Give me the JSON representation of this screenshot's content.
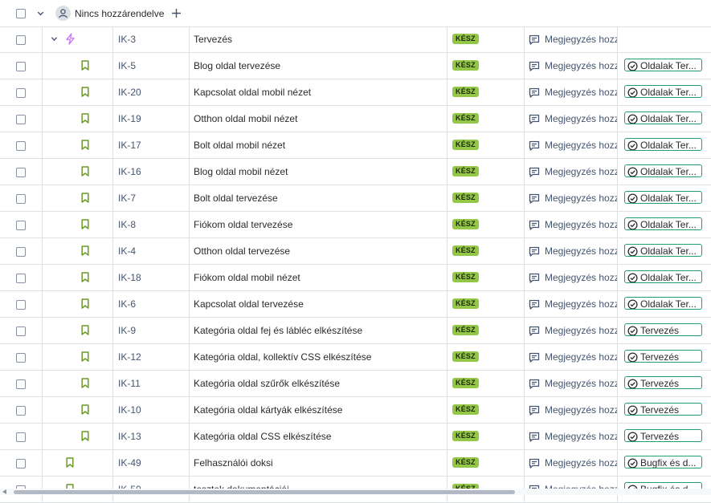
{
  "group": {
    "label": "Nincs hozzárendelve"
  },
  "colors": {
    "status_bg": "#94c748",
    "story_icon": "#6a9a23",
    "epic_icon": "#c97cf4",
    "parent_border": "#22a06b"
  },
  "rows": [
    {
      "type": "epic",
      "expand": true,
      "key": "IK-3",
      "summary": "Tervezés",
      "status": "KÉSZ",
      "comment": "Megjegyzés hozzáadása",
      "parent": ""
    },
    {
      "type": "story",
      "key": "IK-5",
      "summary": "Blog oldal tervezése",
      "status": "KÉSZ",
      "comment": "Megjegyzés hozzáadása",
      "parent": "Oldalak Tervezése"
    },
    {
      "type": "story",
      "key": "IK-20",
      "summary": "Kapcsolat oldal mobil nézet",
      "status": "KÉSZ",
      "comment": "Megjegyzés hozzáadása",
      "parent": "Oldalak Tervezése"
    },
    {
      "type": "story",
      "key": "IK-19",
      "summary": "Otthon oldal mobil nézet",
      "status": "KÉSZ",
      "comment": "Megjegyzés hozzáadása",
      "parent": "Oldalak Tervezése"
    },
    {
      "type": "story",
      "key": "IK-17",
      "summary": "Bolt oldal mobil nézet",
      "status": "KÉSZ",
      "comment": "Megjegyzés hozzáadása",
      "parent": "Oldalak Tervezése"
    },
    {
      "type": "story",
      "key": "IK-16",
      "summary": "Blog oldal mobil nézet",
      "status": "KÉSZ",
      "comment": "Megjegyzés hozzáadása",
      "parent": "Oldalak Tervezése"
    },
    {
      "type": "story",
      "key": "IK-7",
      "summary": "Bolt oldal tervezése",
      "status": "KÉSZ",
      "comment": "Megjegyzés hozzáadása",
      "parent": "Oldalak Tervezése"
    },
    {
      "type": "story",
      "key": "IK-8",
      "summary": "Fiókom oldal tervezése",
      "status": "KÉSZ",
      "comment": "Megjegyzés hozzáadása",
      "parent": "Oldalak Tervezése"
    },
    {
      "type": "story",
      "key": "IK-4",
      "summary": "Otthon oldal tervezése",
      "status": "KÉSZ",
      "comment": "Megjegyzés hozzáadása",
      "parent": "Oldalak Tervezése"
    },
    {
      "type": "story",
      "key": "IK-18",
      "summary": "Fiókom oldal mobil nézet",
      "status": "KÉSZ",
      "comment": "Megjegyzés hozzáadása",
      "parent": "Oldalak Tervezése"
    },
    {
      "type": "story",
      "key": "IK-6",
      "summary": "Kapcsolat oldal tervezése",
      "status": "KÉSZ",
      "comment": "Megjegyzés hozzáadása",
      "parent": "Oldalak Tervezése"
    },
    {
      "type": "story",
      "key": "IK-9",
      "summary": "Kategória oldal fej és lábléc elkészítése",
      "status": "KÉSZ",
      "comment": "Megjegyzés hozzáadása",
      "parent": "Tervezés"
    },
    {
      "type": "story",
      "key": "IK-12",
      "summary": "Kategória oldal, kollektív CSS elkészítése",
      "status": "KÉSZ",
      "comment": "Megjegyzés hozzáadása",
      "parent": "Tervezés"
    },
    {
      "type": "story",
      "key": "IK-11",
      "summary": "Kategória oldal szűrők elkészítése",
      "status": "KÉSZ",
      "comment": "Megjegyzés hozzáadása",
      "parent": "Tervezés"
    },
    {
      "type": "story",
      "key": "IK-10",
      "summary": "Kategória oldal kártyák elkészítése",
      "status": "KÉSZ",
      "comment": "Megjegyzés hozzáadása",
      "parent": "Tervezés"
    },
    {
      "type": "story",
      "key": "IK-13",
      "summary": "Kategória oldal CSS elkészítése",
      "status": "KÉSZ",
      "comment": "Megjegyzés hozzáadása",
      "parent": "Tervezés"
    },
    {
      "type": "story-top",
      "key": "IK-49",
      "summary": "Felhasználói doksi",
      "status": "KÉSZ",
      "comment": "Megjegyzés hozzáadása",
      "parent": "Bugfix és dokumentáció"
    },
    {
      "type": "story-top",
      "key": "IK-50",
      "summary": "tesztek dokumentációi",
      "status": "KÉSZ",
      "comment": "Megjegyzés hozzáadása",
      "parent": "Bugfix és dokumentáció"
    }
  ]
}
